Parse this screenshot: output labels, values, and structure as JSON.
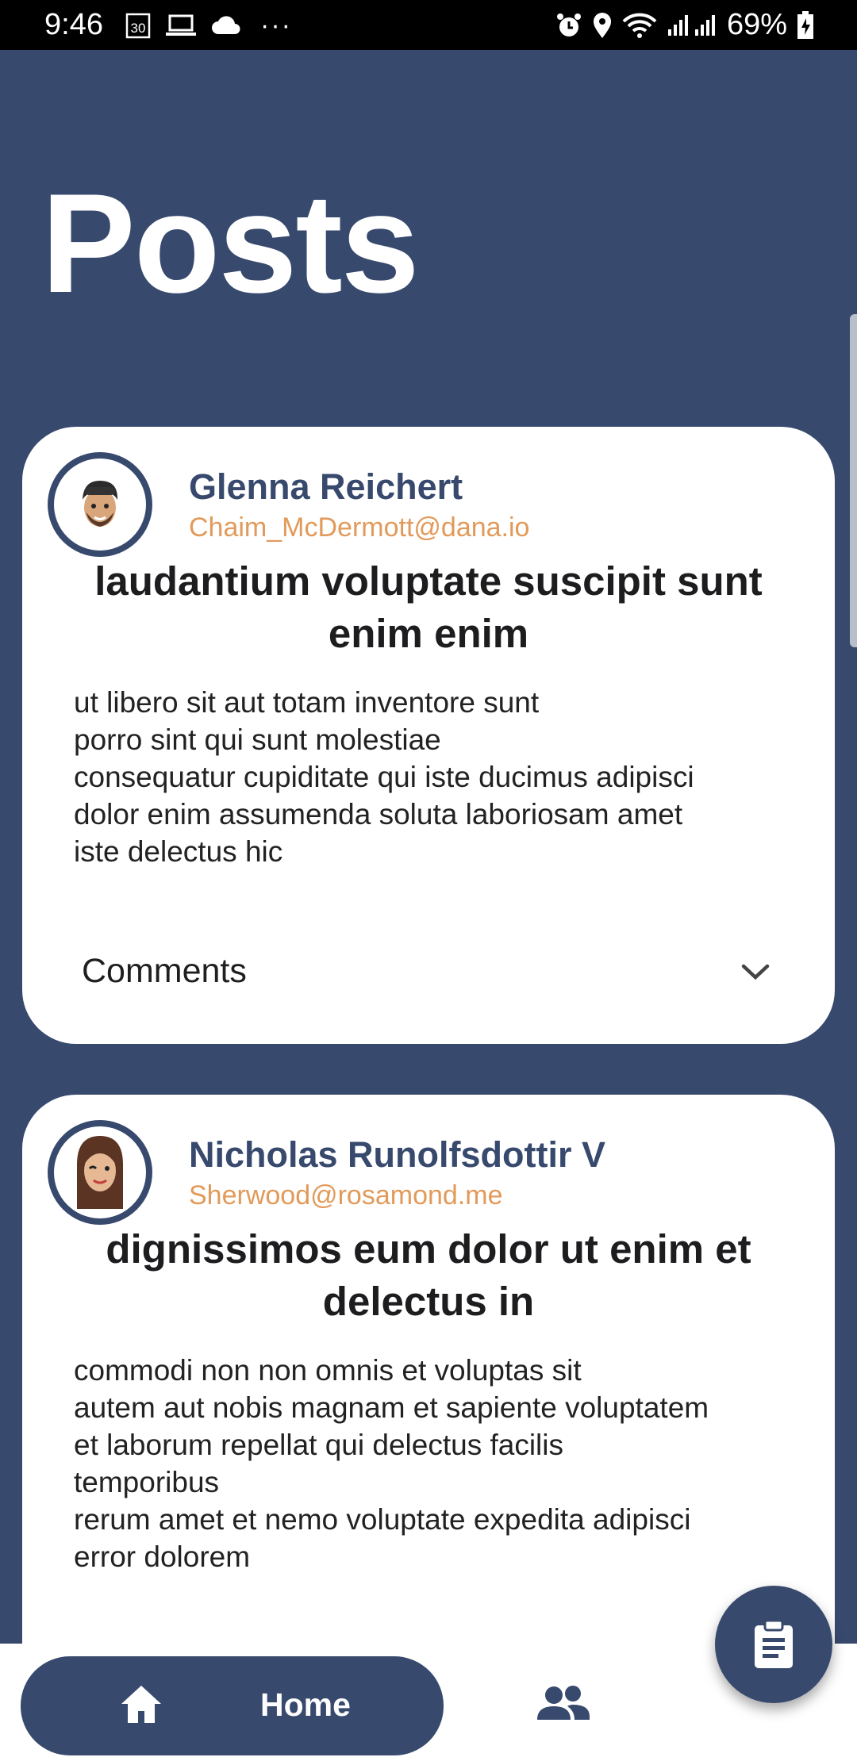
{
  "status_bar": {
    "time": "9:46",
    "calendar_badge": "30",
    "more_icons": "···",
    "battery_percent": "69%",
    "icons": [
      "calendar-icon",
      "laptop-icon",
      "cloud-icon",
      "alarm-icon",
      "location-icon",
      "wifi-icon",
      "signal-icon",
      "battery-icon"
    ]
  },
  "page": {
    "title": "Posts"
  },
  "posts": [
    {
      "author_name": "Glenna Reichert",
      "author_email": "Chaim_McDermott@dana.io",
      "title": "laudantium voluptate suscipit sunt enim enim",
      "body": "ut libero sit aut totam inventore sunt\nporro sint qui sunt molestiae\nconsequatur cupiditate qui iste ducimus adipisci\ndolor enim assumenda soluta laboriosam amet\niste delectus hic",
      "comments_label": "Comments"
    },
    {
      "author_name": "Nicholas Runolfsdottir V",
      "author_email": "Sherwood@rosamond.me",
      "title": "dignissimos eum dolor ut enim et delectus in",
      "body": "commodi non non omnis et voluptas sit\nautem aut nobis magnam et sapiente voluptatem\net laborum repellat qui delectus facilis\ntemporibus\nrerum amet et nemo voluptate expedita adipisci\nerror dolorem"
    }
  ],
  "bottom_nav": {
    "home_label": "Home"
  },
  "colors": {
    "primary": "#38496e",
    "accent_email": "#e29a5a",
    "card_bg": "#ffffff"
  }
}
